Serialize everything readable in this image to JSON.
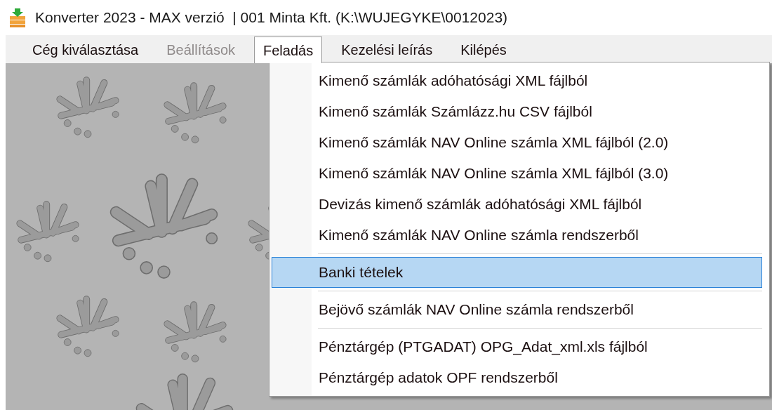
{
  "window": {
    "title": "Konverter 2023 - MAX verzió  | 001 Minta Kft. (K:\\WUJEGYKE\\0012023)"
  },
  "menu_bar": [
    {
      "label": "Cég kiválasztása",
      "selected": false,
      "disabled": false
    },
    {
      "label": "Beállítások",
      "selected": false,
      "disabled": true
    },
    {
      "label": "Feladás",
      "selected": true,
      "disabled": false
    },
    {
      "label": "Kezelési leírás",
      "selected": false,
      "disabled": false
    },
    {
      "label": "Kilépés",
      "selected": false,
      "disabled": false
    }
  ],
  "dropdown": [
    {
      "kind": "item",
      "label": "Kimenő számlák adóhatósági XML fájlból",
      "selected": false
    },
    {
      "kind": "item",
      "label": "Kimenő számlák Számlázz.hu CSV fájlból",
      "selected": false
    },
    {
      "kind": "item",
      "label": "Kimenő számlák NAV Online számla XML fájlból (2.0)",
      "selected": false
    },
    {
      "kind": "item",
      "label": "Kimenő számlák NAV Online számla XML fájlból (3.0)",
      "selected": false
    },
    {
      "kind": "item",
      "label": "Devizás kimenő számlák adóhatósági XML fájlból",
      "selected": false
    },
    {
      "kind": "item",
      "label": "Kimenő számlák NAV Online számla rendszerből",
      "selected": false
    },
    {
      "kind": "separator"
    },
    {
      "kind": "item",
      "label": "Banki tételek",
      "selected": true
    },
    {
      "kind": "separator"
    },
    {
      "kind": "item",
      "label": "Bejövő számlák NAV Online számla rendszerből",
      "selected": false
    },
    {
      "kind": "separator"
    },
    {
      "kind": "item",
      "label": "Pénztárgép (PTGADAT) OPG_Adat_xml.xls fájlból",
      "selected": false
    },
    {
      "kind": "item",
      "label": "Pénztárgép adatok OPF rendszerből",
      "selected": false
    }
  ]
}
